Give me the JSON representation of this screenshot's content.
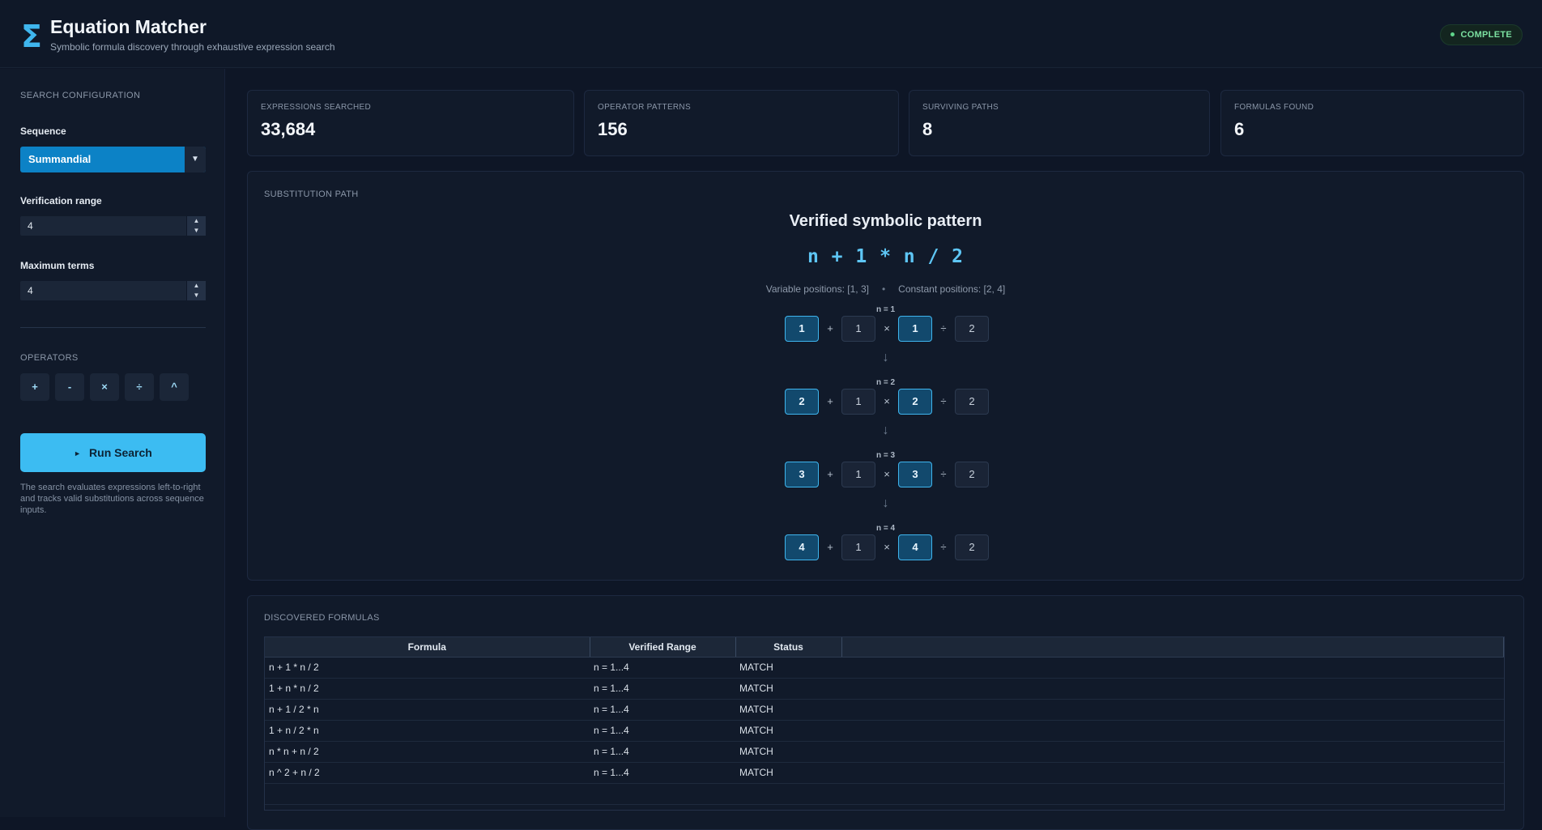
{
  "header": {
    "logo_glyph": "Σ",
    "title": "Equation Matcher",
    "subtitle": "Symbolic formula discovery through exhaustive expression search",
    "status": "COMPLETE"
  },
  "sidebar": {
    "section_label": "SEARCH CONFIGURATION",
    "sequence_label": "Sequence",
    "sequence_value": "Summandial",
    "range_label": "Verification range",
    "range_value": "4",
    "terms_label": "Maximum terms",
    "terms_value": "4",
    "operators_label": "OPERATORS",
    "operators": [
      "+",
      "-",
      "×",
      "÷",
      "^"
    ],
    "run_label": "Run Search",
    "help": "The search evaluates expressions left-to-right and tracks valid substitutions across sequence inputs."
  },
  "stats": [
    {
      "label": "EXPRESSIONS SEARCHED",
      "value": "33,684"
    },
    {
      "label": "OPERATOR PATTERNS",
      "value": "156"
    },
    {
      "label": "SURVIVING PATHS",
      "value": "8"
    },
    {
      "label": "FORMULAS FOUND",
      "value": "6"
    }
  ],
  "substitution": {
    "label": "SUBSTITUTION PATH",
    "title": "Verified symbolic pattern",
    "expression": "n + 1 * n / 2",
    "variable_positions": "Variable positions: [1, 3]",
    "separator": "•",
    "constant_positions": "Constant positions: [2, 4]",
    "arrow": "↓",
    "steps": [
      {
        "label": "n = 1",
        "tokens": [
          "1",
          "+",
          "1",
          "×",
          "1",
          "÷",
          "2"
        ]
      },
      {
        "label": "n = 2",
        "tokens": [
          "2",
          "+",
          "1",
          "×",
          "2",
          "÷",
          "2"
        ]
      },
      {
        "label": "n = 3",
        "tokens": [
          "3",
          "+",
          "1",
          "×",
          "3",
          "÷",
          "2"
        ]
      },
      {
        "label": "n = 4",
        "tokens": [
          "4",
          "+",
          "1",
          "×",
          "4",
          "÷",
          "2"
        ]
      }
    ]
  },
  "formulas": {
    "label": "DISCOVERED FORMULAS",
    "columns": [
      "Formula",
      "Verified Range",
      "Status"
    ],
    "rows": [
      {
        "formula": "n + 1 * n / 2",
        "range": "n = 1...4",
        "status": "MATCH"
      },
      {
        "formula": "1 + n * n / 2",
        "range": "n = 1...4",
        "status": "MATCH"
      },
      {
        "formula": "n + 1 / 2 * n",
        "range": "n = 1...4",
        "status": "MATCH"
      },
      {
        "formula": "1 + n / 2 * n",
        "range": "n = 1...4",
        "status": "MATCH"
      },
      {
        "formula": "n * n + n / 2",
        "range": "n = 1...4",
        "status": "MATCH"
      },
      {
        "formula": "n ^ 2 + n / 2",
        "range": "n = 1...4",
        "status": "MATCH"
      }
    ]
  },
  "colors": {
    "accent": "#3cbcf2",
    "select": "#0c82c6",
    "background": "#0e1626",
    "panel": "#111a2a",
    "success": "#7be0a0"
  }
}
